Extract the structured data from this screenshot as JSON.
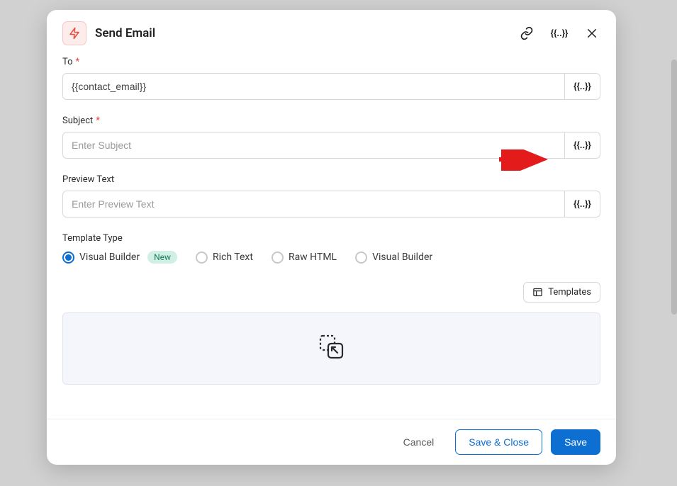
{
  "header": {
    "title": "Send Email"
  },
  "fields": {
    "to": {
      "label": "To",
      "value": "{{contact_email}}"
    },
    "subject": {
      "label": "Subject",
      "placeholder": "Enter Subject"
    },
    "preview": {
      "label": "Preview Text",
      "placeholder": "Enter Preview Text"
    }
  },
  "templateType": {
    "label": "Template Type",
    "badge_new": "New",
    "options": [
      "Visual Builder",
      "Rich Text",
      "Raw HTML",
      "Visual Builder"
    ],
    "selectedIndex": 0
  },
  "buttons": {
    "templates": "Templates",
    "cancel": "Cancel",
    "saveClose": "Save & Close",
    "save": "Save"
  },
  "glyphs": {
    "merge": "{{..}}"
  }
}
